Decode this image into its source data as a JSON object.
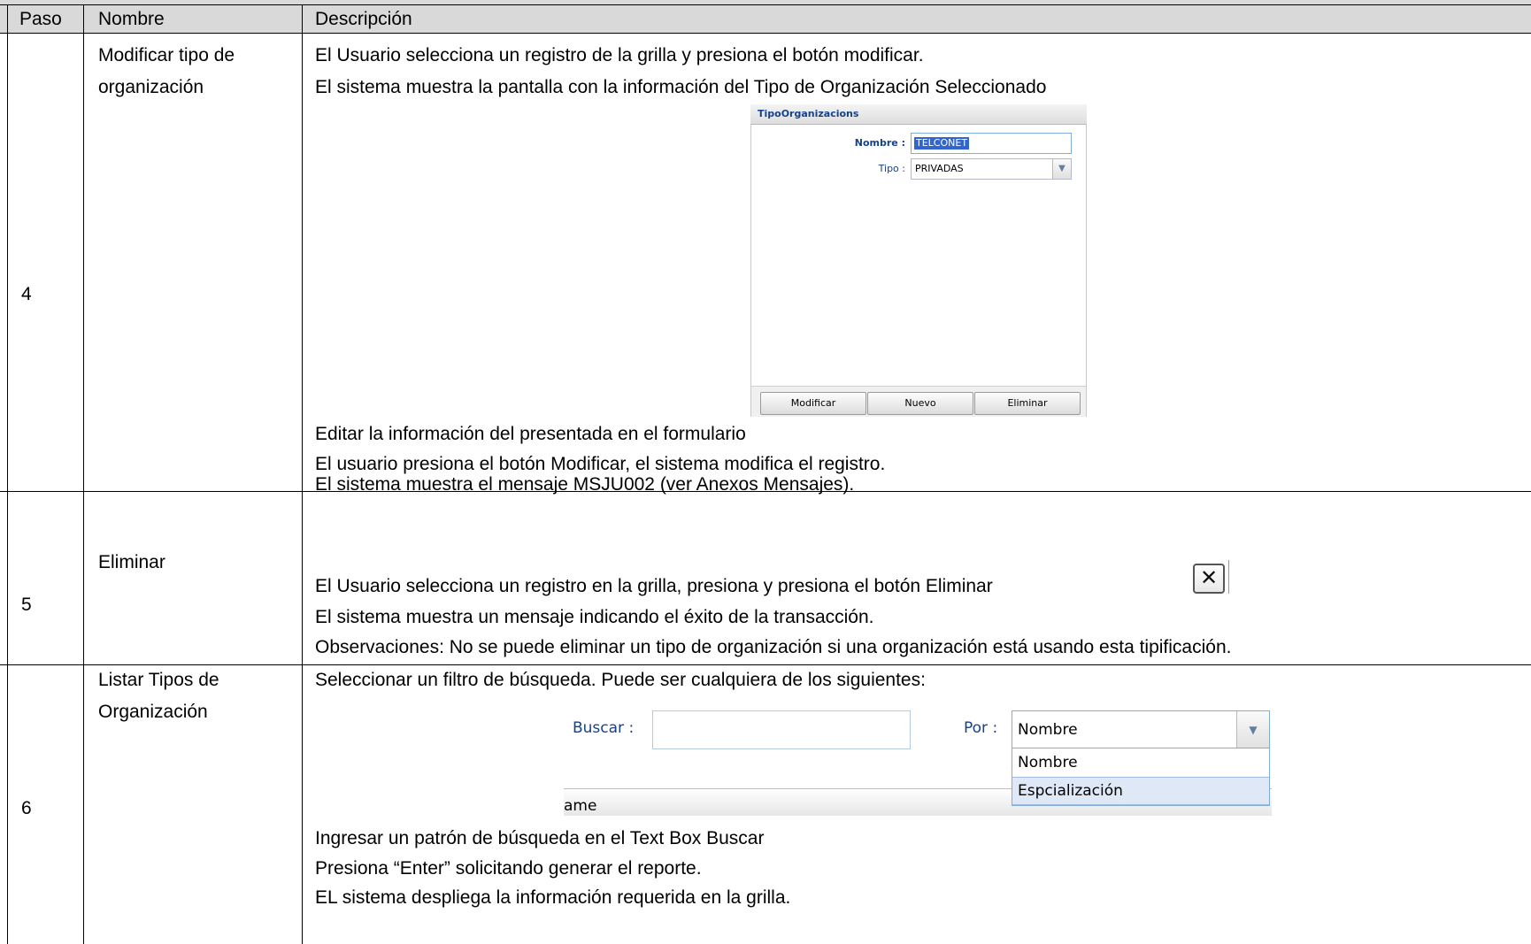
{
  "table": {
    "headers": [
      "Paso",
      "Nombre",
      "Descripción"
    ],
    "rows": [
      {
        "paso": "4",
        "nombre": [
          "Modificar tipo de",
          "organización"
        ],
        "lines_before": [
          "El Usuario selecciona un registro de la grilla y presiona el botón modificar.",
          "El sistema muestra la pantalla con la información del Tipo de Organización Seleccionado"
        ],
        "lines_after": [
          "Editar la información del presentada en el formulario",
          "El usuario presiona el botón Modificar, el sistema modifica el registro.",
          "El sistema muestra el mensaje MSJU002 (ver Anexos Mensajes)."
        ]
      },
      {
        "paso": "5",
        "nombre": [
          "Eliminar"
        ],
        "lines": [
          "El Usuario selecciona un registro en la grilla, presiona y presiona el botón Eliminar",
          "El sistema muestra un mensaje indicando el éxito de la transacción.",
          "Observaciones: No se puede eliminar un tipo de organización si una organización está usando esta tipificación."
        ]
      },
      {
        "paso": "6",
        "nombre": [
          "Listar Tipos de",
          "Organización"
        ],
        "lines_before": [
          "Seleccionar un filtro de búsqueda. Puede ser cualquiera de los siguientes:"
        ],
        "lines_after": [
          "Ingresar un patrón de búsqueda en el Text Box Buscar",
          "Presiona “Enter” solicitando generar  el reporte.",
          "EL sistema despliega la información requerida en la grilla."
        ]
      }
    ]
  },
  "tipo_form": {
    "title": "TipoOrganizacions",
    "nombre_label": "Nombre :",
    "nombre_value": "TELCONET",
    "tipo_label": "Tipo :",
    "tipo_value": "PRIVADAS",
    "buttons": [
      "Modificar",
      "Nuevo",
      "Eliminar"
    ]
  },
  "delete_icon": "close-icon",
  "filter": {
    "buscar_label": "Buscar :",
    "buscar_value": "",
    "por_label": "Por :",
    "por_value": "Nombre",
    "options": [
      "Nombre",
      "Espcialización"
    ],
    "highlighted_option": "Espcialización",
    "grid_header_partial": "ame"
  },
  "colors": {
    "header_bg": "#d9d9d9",
    "form_label": "#15428b",
    "selection": "#3366cc"
  }
}
